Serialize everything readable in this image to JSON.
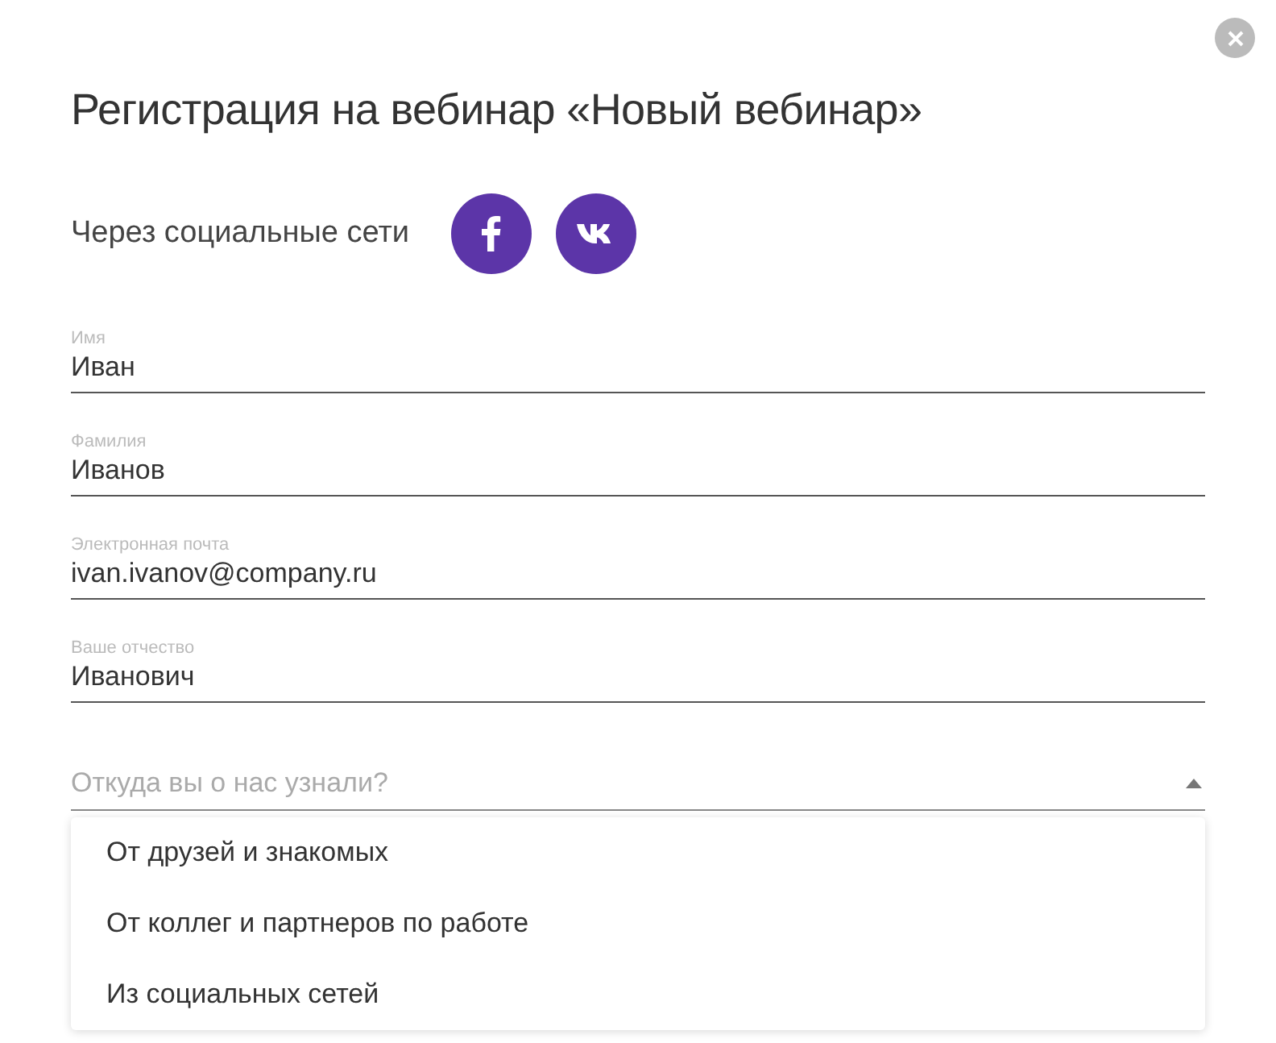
{
  "title": "Регистрация на вебинар «Новый вебинар»",
  "social": {
    "label": "Через социальные сети",
    "buttons": [
      {
        "kind": "facebook"
      },
      {
        "kind": "vk"
      }
    ]
  },
  "fields": [
    {
      "label": "Имя",
      "value": "Иван"
    },
    {
      "label": "Фамилия",
      "value": "Иванов"
    },
    {
      "label": "Электронная почта",
      "value": "ivan.ivanov@company.ru"
    },
    {
      "label": "Ваше отчество",
      "value": "Иванович"
    }
  ],
  "source_select": {
    "placeholder": "Откуда вы о нас узнали?",
    "expanded": true,
    "options": [
      {
        "label": "От друзей и знакомых",
        "selected": false
      },
      {
        "label": "От коллег и партнеров по работе",
        "selected": false
      },
      {
        "label": "Из социальных сетей",
        "selected": false
      }
    ]
  }
}
